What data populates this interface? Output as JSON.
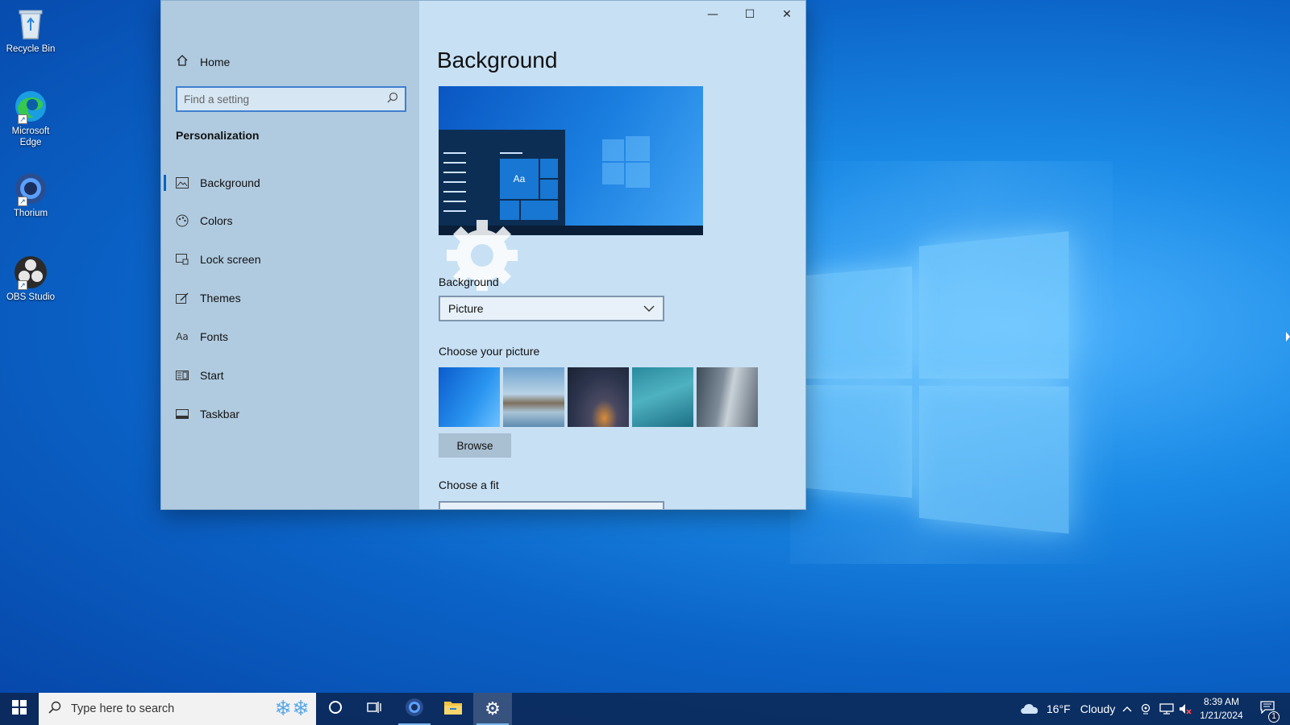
{
  "desktop": {
    "icons": [
      {
        "label": "Recycle Bin"
      },
      {
        "label": "Microsoft Edge"
      },
      {
        "label": "Thorium"
      },
      {
        "label": "OBS Studio"
      }
    ]
  },
  "window": {
    "controls": {
      "minimize": "—",
      "maximize": "☐",
      "close": "✕"
    },
    "sidebar": {
      "home_label": "Home",
      "search_placeholder": "Find a setting",
      "section_title": "Personalization",
      "items": [
        {
          "label": "Background",
          "icon": "picture-icon",
          "active": true
        },
        {
          "label": "Colors",
          "icon": "palette-icon"
        },
        {
          "label": "Lock screen",
          "icon": "lock-screen-icon"
        },
        {
          "label": "Themes",
          "icon": "themes-icon"
        },
        {
          "label": "Fonts",
          "icon": "fonts-icon"
        },
        {
          "label": "Start",
          "icon": "start-icon"
        },
        {
          "label": "Taskbar",
          "icon": "taskbar-icon"
        }
      ]
    },
    "content": {
      "title": "Background",
      "preview_sample_text": "Aa",
      "background_label": "Background",
      "background_value": "Picture",
      "choose_picture_label": "Choose your picture",
      "browse_label": "Browse",
      "choose_fit_label": "Choose a fit"
    }
  },
  "taskbar": {
    "search_placeholder": "Type here to search",
    "weather": {
      "temp": "16°F",
      "condition": "Cloudy"
    },
    "clock": {
      "time": "8:39 AM",
      "date": "1/21/2024"
    },
    "notification_count": "1"
  },
  "colors": {
    "accent": "#0067c0",
    "sidebar_bg": "#b0cbe0",
    "content_bg": "#c7e0f4"
  }
}
